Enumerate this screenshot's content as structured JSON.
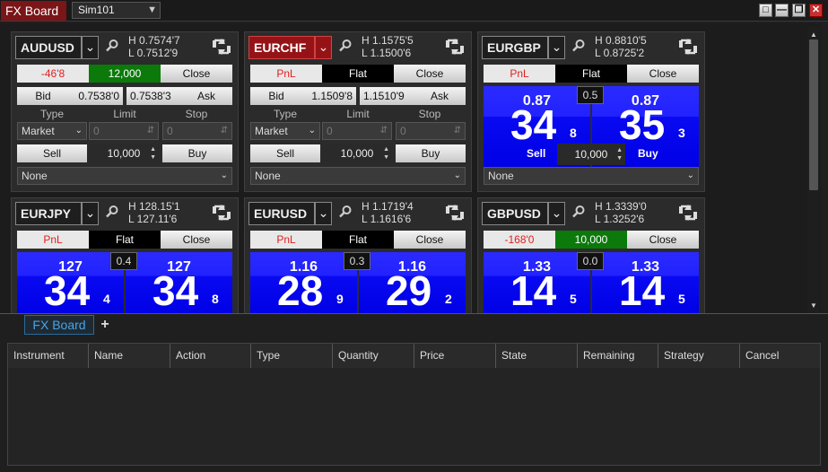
{
  "window": {
    "title": "FX Board",
    "account": "Sim101",
    "controls": [
      "□",
      "—",
      "❐",
      "✕"
    ]
  },
  "labels": {
    "type": "Type",
    "limit": "Limit",
    "stop": "Stop",
    "sell": "Sell",
    "buy": "Buy",
    "bid": "Bid",
    "ask": "Ask",
    "pnl": "PnL",
    "flat": "Flat",
    "close": "Close",
    "market": "Market",
    "none": "None",
    "zero": "0"
  },
  "tiles": [
    {
      "symbol": "AUDUSD",
      "high": "H  0.7574'7",
      "low": "L  0.7512'9",
      "pnl": "-46'8",
      "position": "12,000",
      "bid": "0.7538'0",
      "ask": "0.7538'3",
      "qty": "10,000"
    },
    {
      "symbol": "EURCHF",
      "high": "H  1.1575'5",
      "low": "L  1.1500'6",
      "pnl": "PnL",
      "position": "Flat",
      "bid": "1.1509'8",
      "ask": "1.1510'9",
      "qty": "10,000"
    },
    {
      "symbol": "EURGBP",
      "high": "H  0.8810'5",
      "low": "L  0.8725'2",
      "pnl": "PnL",
      "position": "Flat",
      "bid_big": "0.87",
      "bid_pips": "34",
      "bid_frac": "8",
      "ask_big": "0.87",
      "ask_pips": "35",
      "ask_frac": "3",
      "spread": "0.5",
      "qty": "10,000"
    },
    {
      "symbol": "EURJPY",
      "high": "H  128.15'1",
      "low": "L  127.11'6",
      "pnl": "PnL",
      "position": "Flat",
      "bid_big": "127",
      "bid_pips": "34",
      "bid_frac": "4",
      "ask_big": "127",
      "ask_pips": "34",
      "ask_frac": "8",
      "spread": "0.4"
    },
    {
      "symbol": "EURUSD",
      "high": "H  1.1719'4",
      "low": "L  1.1616'6",
      "pnl": "PnL",
      "position": "Flat",
      "bid_big": "1.16",
      "bid_pips": "28",
      "bid_frac": "9",
      "ask_big": "1.16",
      "ask_pips": "29",
      "ask_frac": "2",
      "spread": "0.3"
    },
    {
      "symbol": "GBPUSD",
      "high": "H  1.3339'0",
      "low": "L  1.3252'6",
      "pnl": "-168'0",
      "position": "10,000",
      "bid_big": "1.33",
      "bid_pips": "14",
      "bid_frac": "5",
      "ask_big": "1.33",
      "ask_pips": "14",
      "ask_frac": "5",
      "spread": "0.0"
    }
  ],
  "tabs": {
    "active": "FX Board",
    "add": "+"
  },
  "orders": {
    "columns": [
      "Instrument",
      "Name",
      "Action",
      "Type",
      "Quantity",
      "Price",
      "State",
      "Remaining",
      "Strategy",
      "Cancel"
    ]
  }
}
